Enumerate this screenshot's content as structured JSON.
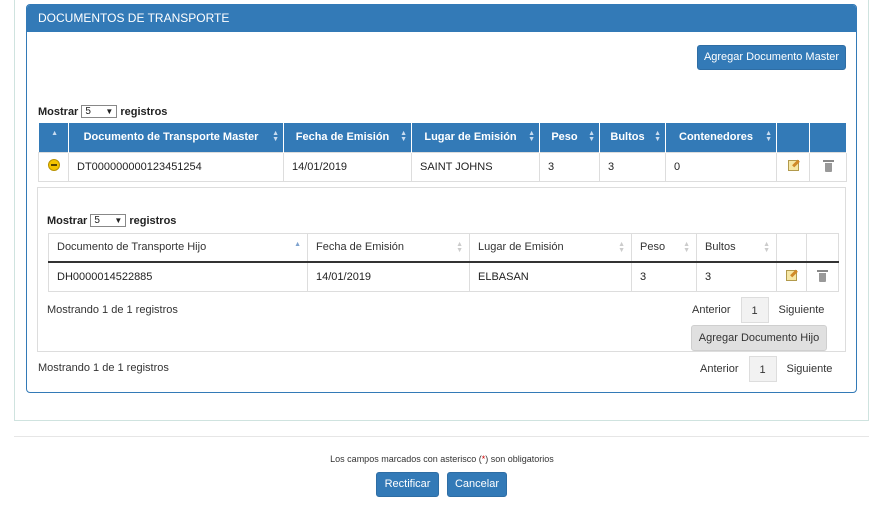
{
  "panel": {
    "title": "DOCUMENTOS DE TRANSPORTE"
  },
  "master": {
    "add_button": "Agregar Documento Master",
    "length": {
      "prefix": "Mostrar",
      "value": "5",
      "suffix": "registros"
    },
    "columns": [
      "Documento de Transporte Master",
      "Fecha de Emisión",
      "Lugar de Emisión",
      "Peso",
      "Bultos",
      "Contenedores"
    ],
    "row": {
      "documento": "DT000000000123451254",
      "fecha": "14/01/2019",
      "lugar": "SAINT JOHNS",
      "peso": "3",
      "bultos": "3",
      "contenedores": "0"
    },
    "info": "Mostrando 1 de 1 registros",
    "pager": {
      "prev": "Anterior",
      "page": "1",
      "next": "Siguiente"
    }
  },
  "child": {
    "length": {
      "prefix": "Mostrar",
      "value": "5",
      "suffix": "registros"
    },
    "columns": [
      "Documento de Transporte Hijo",
      "Fecha de Emisión",
      "Lugar de Emisión",
      "Peso",
      "Bultos"
    ],
    "row": {
      "documento": "DH0000014522885",
      "fecha": "14/01/2019",
      "lugar": "ELBASAN",
      "peso": "3",
      "bultos": "3"
    },
    "info": "Mostrando 1 de 1 registros",
    "pager": {
      "prev": "Anterior",
      "page": "1",
      "next": "Siguiente"
    },
    "add_button": "Agregar Documento Hijo"
  },
  "footer": {
    "note_before": "Los campos marcados con asterisco (",
    "asterisk": "*",
    "note_after": ") son obligatorios",
    "rectify_button": "Rectificar",
    "cancel_button": "Cancelar"
  },
  "colors": {
    "primary": "#337ab7",
    "required": "#cc0000"
  },
  "icons": [
    "sort-icon",
    "collapse-icon",
    "edit-icon",
    "trash-icon",
    "dropdown-arrow-icon"
  ]
}
